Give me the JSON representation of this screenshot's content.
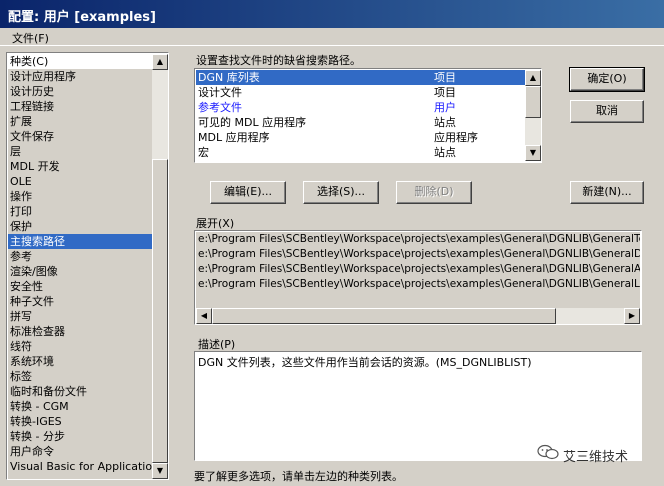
{
  "window": {
    "title": "配置: 用户 [examples]"
  },
  "menubar": {
    "file": "文件(F)"
  },
  "categories": {
    "header": "种类(C)",
    "items": [
      "设计应用程序",
      "设计历史",
      "工程链接",
      "扩展",
      "文件保存",
      "层",
      "MDL 开发",
      "OLE",
      "操作",
      "打印",
      "保护",
      "主搜索路径",
      "参考",
      "渲染/图像",
      "安全性",
      "种子文件",
      "拼写",
      "标准检查器",
      "线符",
      "系统环境",
      "标签",
      "临时和备份文件",
      "转换 - CGM",
      "转换-IGES",
      "转换 - 分步",
      "用户命令",
      "Visual Basic for Applications"
    ],
    "selected": "主搜索路径"
  },
  "search_paths": {
    "label": "设置查找文件时的缺省搜索路径。",
    "rows": [
      {
        "name": "DGN 库列表",
        "type": "项目"
      },
      {
        "name": "设计文件",
        "type": "项目"
      },
      {
        "name": "参考文件",
        "type": "用户"
      },
      {
        "name": "可见的 MDL 应用程序",
        "type": "站点"
      },
      {
        "name": "MDL 应用程序",
        "type": "应用程序"
      },
      {
        "name": "宏",
        "type": "站点"
      }
    ]
  },
  "buttons": {
    "ok": "确定(O)",
    "cancel": "取消",
    "edit": "编辑(E)...",
    "select": "选择(S)...",
    "delete": "删除(D)",
    "new": "新建(N)..."
  },
  "expand": {
    "label": "展开(X)",
    "rows": [
      "e:\\Program Files\\SCBentley\\Workspace\\projects\\examples\\General\\DGNLIB\\GeneralTextStyles.dgnlib",
      "e:\\Program Files\\SCBentley\\Workspace\\projects\\examples\\General\\DGNLIB\\GeneralDimStyles.dgnlib",
      "e:\\Program Files\\SCBentley\\Workspace\\projects\\examples\\General\\DGNLIB\\GeneralAnnotation.dgnlib",
      "e:\\Program Files\\SCBentley\\Workspace\\projects\\examples\\General\\DGNLIB\\GeneralLevels.dgnlib"
    ]
  },
  "description": {
    "label": "描述(P)",
    "text": "DGN 文件列表，这些文件用作当前会话的资源。(MS_DGNLIBLIST)"
  },
  "status": {
    "hint": "要了解更多选项，请单击左边的种类列表。"
  },
  "watermark": {
    "text": "艾三维技术"
  },
  "icons": [
    "up-arrow-icon",
    "down-arrow-icon",
    "left-arrow-icon",
    "right-arrow-icon",
    "wechat-icon"
  ]
}
